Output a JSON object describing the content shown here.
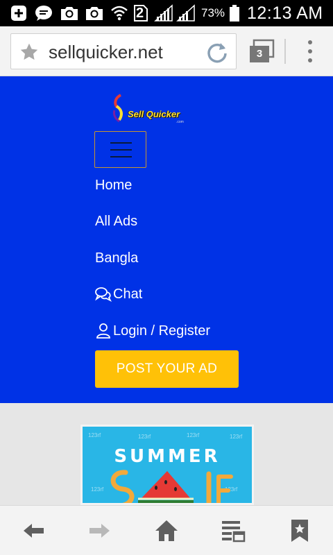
{
  "status_bar": {
    "battery_percent": "73%",
    "time": "12:13 AM",
    "notification_count": "2",
    "icons": [
      "add-icon",
      "chat-bubble-icon",
      "camera-icon",
      "camera-icon",
      "wifi-icon",
      "sim-2-icon",
      "signal-icon",
      "signal-icon",
      "battery-icon"
    ]
  },
  "browser": {
    "url": "sellquicker.net",
    "tab_count": "3"
  },
  "site": {
    "logo_text": "Sell Quicker",
    "logo_sub": ".com",
    "nav": {
      "home": "Home",
      "all_ads": "All Ads",
      "bangla": "Bangla",
      "chat": "Chat",
      "login": "Login / Register"
    },
    "post_ad_label": "POST YOUR AD"
  },
  "banner": {
    "title": "SUMMER",
    "watermark": "123rf"
  },
  "colors": {
    "header_bg": "#0032e6",
    "post_button_bg": "#ffc107",
    "banner_bg": "#29b6e6"
  }
}
